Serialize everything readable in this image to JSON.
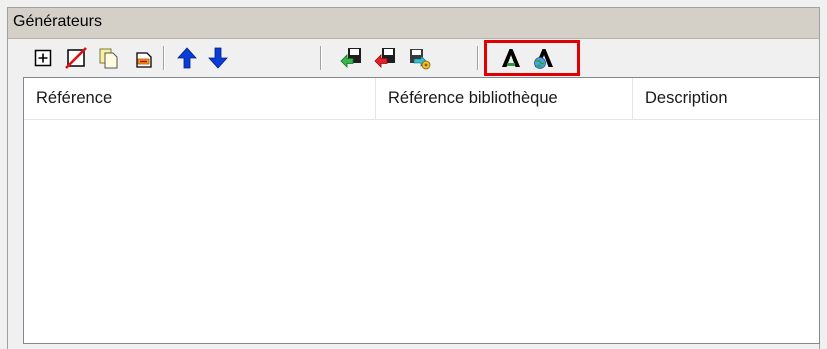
{
  "window": {
    "title": "Générateurs"
  },
  "toolbar": {
    "buttons": [
      {
        "icon": "new-document-icon"
      },
      {
        "icon": "delete-icon"
      },
      {
        "icon": "copy-icon"
      },
      {
        "icon": "properties-icon"
      },
      {
        "icon": "arrow-up-icon"
      },
      {
        "icon": "arrow-down-icon"
      },
      {
        "icon": "import-icon"
      },
      {
        "icon": "export-icon"
      },
      {
        "icon": "update-icon"
      },
      {
        "icon": "generator-icon"
      },
      {
        "icon": "generator-web-icon"
      }
    ],
    "accent_highlight": "#e00000"
  },
  "table": {
    "columns": [
      "Référence",
      "Référence bibliothèque",
      "Description"
    ],
    "rows": []
  }
}
